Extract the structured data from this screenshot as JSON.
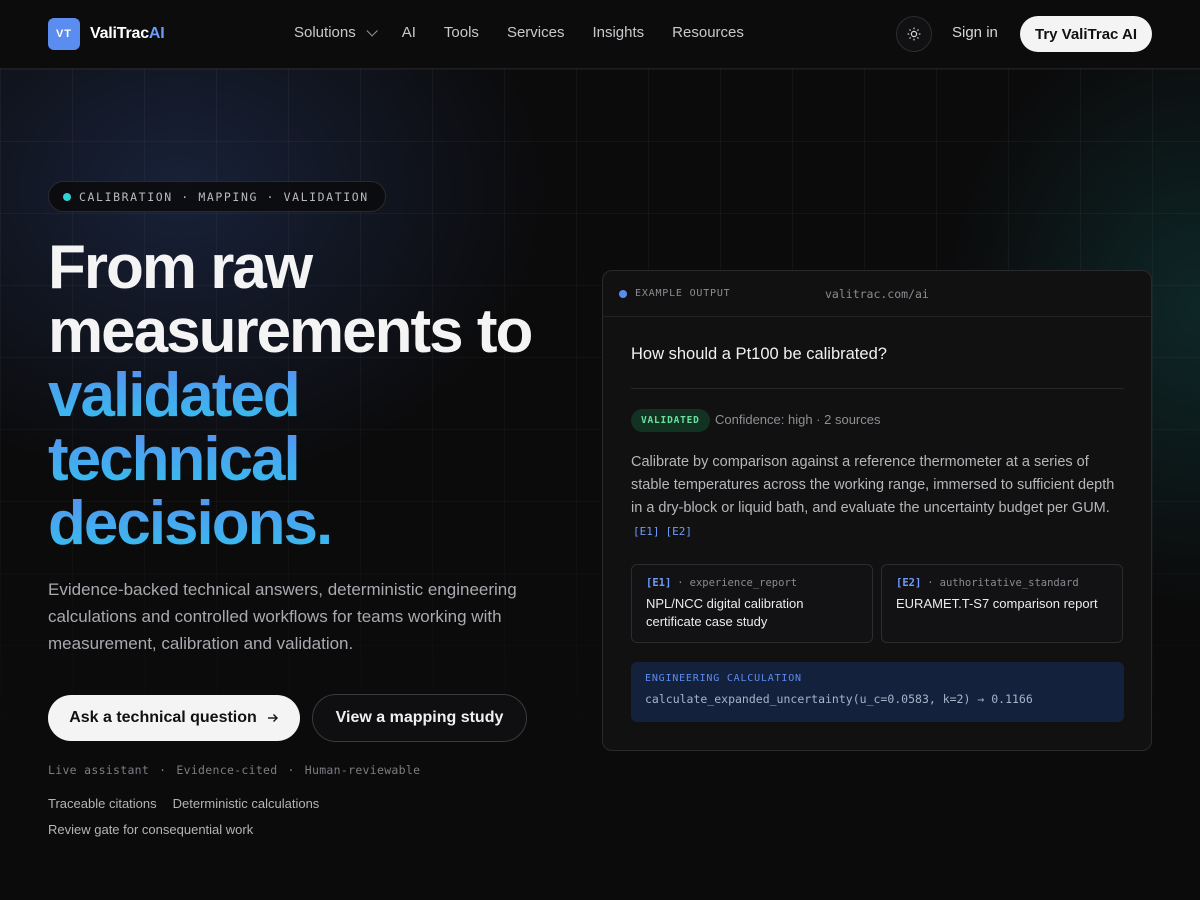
{
  "nav": {
    "logo_mark": "VT",
    "logo_name": "ValiTrac",
    "logo_accent": "AI",
    "links": [
      "Solutions",
      "AI",
      "Tools",
      "Services",
      "Insights",
      "Resources"
    ],
    "theme_icon": "sun-icon",
    "signin": "Sign in",
    "cta": "Try ValiTrac AI"
  },
  "hero": {
    "pill": "CALIBRATION · MAPPING · VALIDATION",
    "headline_line1": "From raw",
    "headline_line2": "measurements to",
    "headline_hl1": "validated",
    "headline_hl2": "technical",
    "headline_hl3": "decisions.",
    "subtitle": "Evidence-backed technical answers, deterministic engineering calculations and controlled workflows for teams working with measurement, calibration and validation.",
    "cta_primary": "Ask a technical question",
    "cta_secondary": "View a mapping study",
    "meta": [
      "Live assistant",
      "·",
      "Evidence-cited",
      "·",
      "Human-reviewable"
    ],
    "features": [
      "Traceable citations",
      "Deterministic calculations",
      "Review gate for consequential work"
    ]
  },
  "card": {
    "label": "EXAMPLE OUTPUT",
    "url": "valitrac.com/ai",
    "question": "How should a Pt100 be calibrated?",
    "badge": "VALIDATED",
    "confidence": "Confidence: high · 2 sources",
    "answer": "Calibrate by comparison against a reference thermometer at a series of stable temperatures across the working range, immersed to sufficient depth in a dry-block or liquid bath, and evaluate the uncertainty budget per GUM.",
    "cite1": "[E1]",
    "cite2": "[E2]",
    "evidence": [
      {
        "tag": "[E1]",
        "sep": "·",
        "type": "experience_report",
        "title": "NPL/NCC digital calibration certificate case study"
      },
      {
        "tag": "[E2]",
        "sep": "·",
        "type": "authoritative_standard",
        "title": "EURAMET.T-S7 comparison report"
      }
    ],
    "calc_label": "ENGINEERING CALCULATION",
    "calc_expr": "calculate_expanded_uncertainty(u_c=0.0583, k=2)",
    "calc_arrow": "→",
    "calc_result": "0.1166"
  },
  "colors": {
    "accent": "#5b8cf0",
    "teal": "#2fd3d6",
    "validated_bg": "#123322",
    "validated_fg": "#6fe0a2"
  }
}
